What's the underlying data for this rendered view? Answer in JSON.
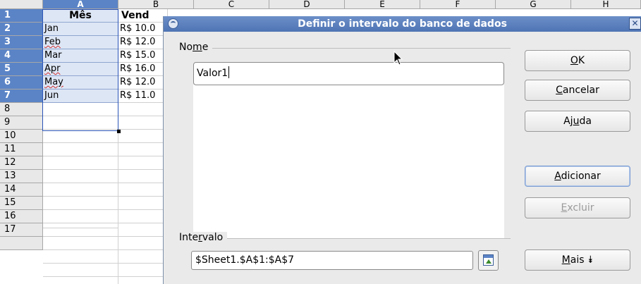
{
  "spreadsheet": {
    "columns": [
      "A",
      "B",
      "C",
      "D",
      "E",
      "F",
      "G",
      "H"
    ],
    "rows": [
      "1",
      "2",
      "3",
      "4",
      "5",
      "6",
      "7",
      "8",
      "9",
      "10",
      "11",
      "12",
      "13",
      "14",
      "15",
      "16",
      "17"
    ],
    "header_a": "Mês",
    "header_b": "Vend",
    "months": [
      "Jan",
      "Feb",
      "Mar",
      "Apr",
      "May",
      "Jun"
    ],
    "sales": [
      "R$ 10.0",
      "R$ 12.0",
      "R$ 15.0",
      "R$ 16.0",
      "R$ 12.0",
      "R$ 11.0"
    ]
  },
  "dialog": {
    "title": "Definir o intervalo do banco de dados",
    "close_glyph": "✕",
    "name_group": {
      "label_pre": "No",
      "label_ul": "m",
      "label_post": "e"
    },
    "name_value": "Valor1",
    "range_group": {
      "label_pre": "Inte",
      "label_ul": "r",
      "label_post": "valo"
    },
    "range_value": "$Sheet1.$A$1:$A$7",
    "buttons": {
      "ok": {
        "ul": "O",
        "rest": "K"
      },
      "cancel": {
        "ul": "C",
        "rest": "ancelar"
      },
      "help": {
        "pre": "Aj",
        "ul": "u",
        "rest": "da"
      },
      "add": {
        "ul": "A",
        "rest": "dicionar"
      },
      "delete": {
        "ul": "E",
        "rest": "xcluir"
      },
      "more": {
        "ul": "M",
        "rest": "ais ",
        "glyph": "⯯"
      }
    }
  },
  "colors": {
    "titlebar": "#5b80bf",
    "selection": "#dde6f5",
    "header_selected": "#5b84c6"
  }
}
